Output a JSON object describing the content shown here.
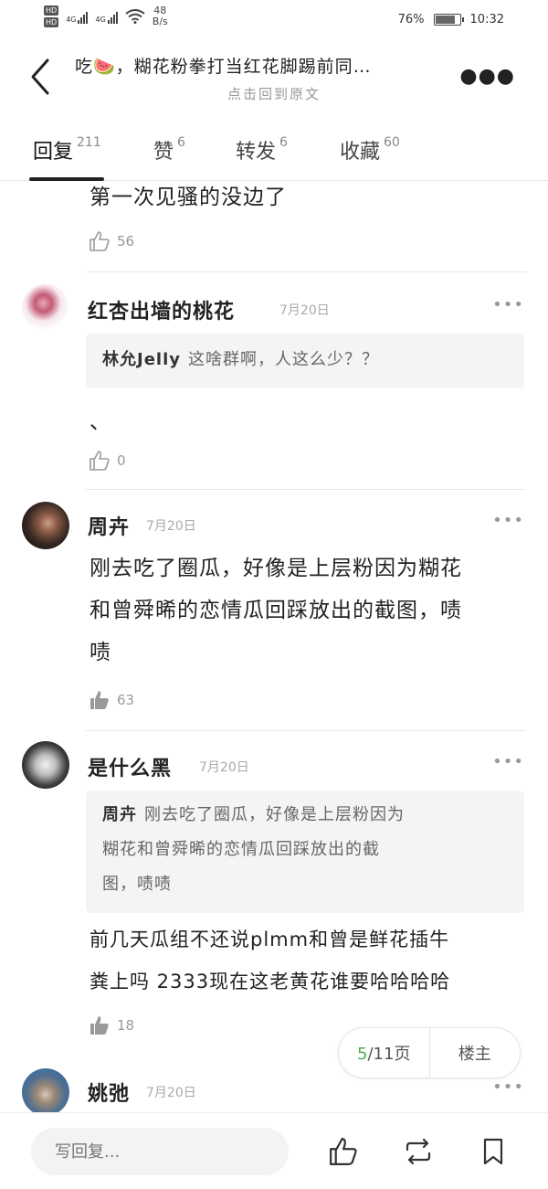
{
  "status_bar": {
    "hd1": "HD",
    "hd2": "HD",
    "net1": "4G",
    "net2": "4G",
    "speed_value": "48",
    "speed_unit": "B/s",
    "battery": "76%",
    "battery_level": 0.76,
    "time": "10:32"
  },
  "header": {
    "title": "吃🍉，糊花粉拳打当红花脚踢前同…",
    "subtitle": "点击回到原文"
  },
  "tabs": [
    {
      "label": "回复",
      "count": "211"
    },
    {
      "label": "赞",
      "count": "6"
    },
    {
      "label": "转发",
      "count": "6"
    },
    {
      "label": "收藏",
      "count": "60"
    }
  ],
  "feed": {
    "top_partial": {
      "text": "第一次见骚的没边了",
      "likes": "56"
    },
    "items": [
      {
        "username": "红杏出墙的桃花",
        "date": "7月20日",
        "quote_author": "林允Jelly",
        "quote_text": "这啥群啊，人这么少？？",
        "text": "、",
        "likes": "0"
      },
      {
        "username": "周卉",
        "date": "7月20日",
        "text_lines": [
          "刚去吃了圈瓜，好像是上层粉因为糊花",
          "和曾舜晞的恋情瓜回踩放出的截图，啧",
          "啧"
        ],
        "likes": "63"
      },
      {
        "username": "是什么黑",
        "date": "7月20日",
        "quote_author": "周卉",
        "quote_lines": [
          "刚去吃了圈瓜，好像是上层粉因为",
          "糊花和曾舜晞的恋情瓜回踩放出的截",
          "图，啧啧"
        ],
        "text_lines": [
          "前几天瓜组不还说plmm和曾是鲜花插牛",
          "粪上吗 2333现在这老黄花谁要哈哈哈哈"
        ],
        "likes": "18"
      },
      {
        "username": "姚弛",
        "date": "7月20日"
      }
    ]
  },
  "pagination": {
    "current": "5",
    "total": "/11页",
    "owner_label": "楼主"
  },
  "bottom_bar": {
    "reply_placeholder": "写回复..."
  }
}
